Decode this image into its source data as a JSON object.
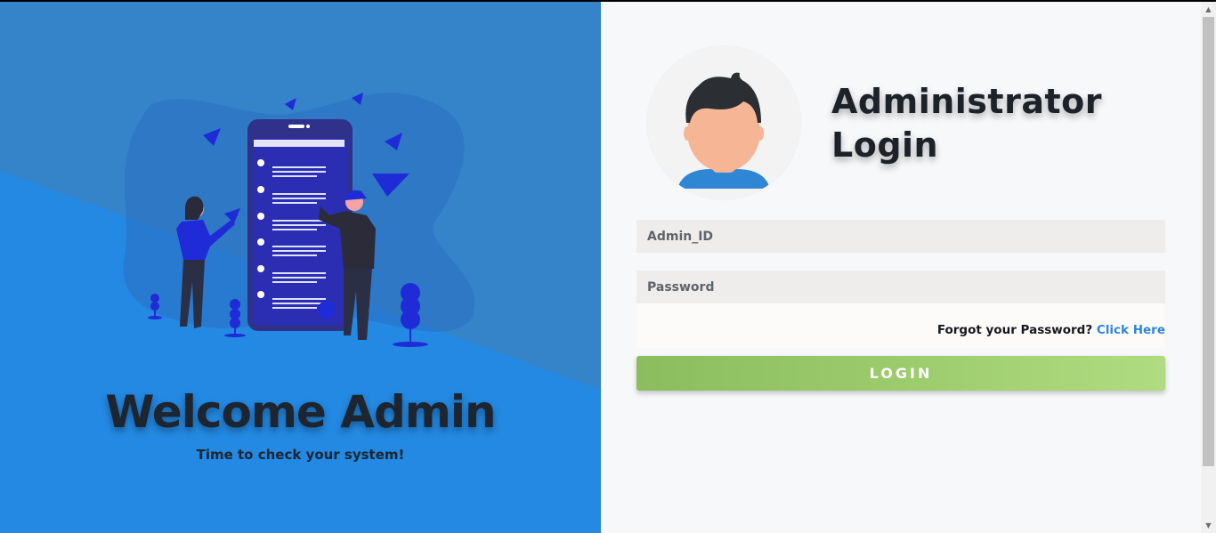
{
  "left": {
    "welcome_title": "Welcome Admin",
    "subtitle": "Time to check your system!"
  },
  "login": {
    "heading_line1": "Administrator",
    "heading_line2": "Login",
    "admin_id_placeholder": "Admin_ID",
    "password_placeholder": "Password",
    "forgot_text": "Forgot your Password?",
    "forgot_link": "Click Here",
    "login_button": "LOGIN"
  },
  "colors": {
    "left_bg": "#2389e2",
    "left_bg_shade": "#3584c9",
    "login_button": "#9ccb6c",
    "link": "#2e86d9"
  },
  "icons": {
    "avatar": "user-avatar-icon",
    "scroll_up": "scroll-up-arrow-icon",
    "scroll_down": "scroll-down-arrow-icon"
  }
}
